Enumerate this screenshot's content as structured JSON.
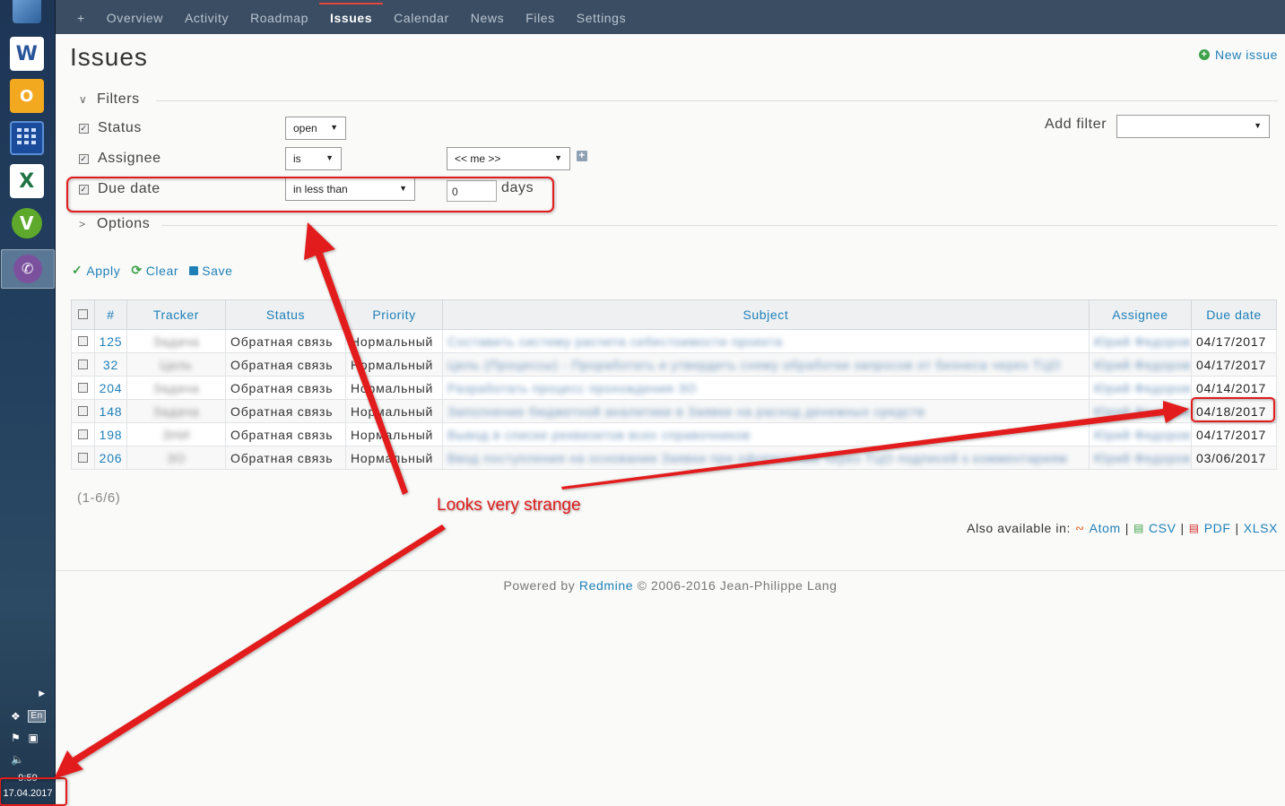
{
  "taskbar": {
    "apps": [
      "computer-icon",
      "word-icon",
      "outlook-icon",
      "calculator-icon",
      "excel-icon",
      "v-app-icon",
      "viber-icon"
    ],
    "app_letters": {
      "word": "W",
      "outlook": "O",
      "excel": "X",
      "v": "V"
    },
    "language": "En",
    "time": "9:59",
    "date": "17.04.2017"
  },
  "menu": {
    "plus": "+",
    "items": [
      "Overview",
      "Activity",
      "Roadmap",
      "Issues",
      "Calendar",
      "News",
      "Files",
      "Settings"
    ],
    "selected": "Issues",
    "accent": "#e8473c"
  },
  "page": {
    "title": "Issues",
    "new_issue": "New issue"
  },
  "filters": {
    "legend": "Filters",
    "rows": [
      {
        "label": "Status",
        "operator": "open",
        "checked": true
      },
      {
        "label": "Assignee",
        "operator": "is",
        "value": "<< me >>",
        "checked": true
      },
      {
        "label": "Due date",
        "operator": "in less than",
        "value": "0",
        "unit": "days",
        "checked": true
      }
    ],
    "add_filter": "Add filter",
    "add_filter_value": ""
  },
  "options": {
    "legend": "Options"
  },
  "actions": {
    "apply": "Apply",
    "clear": "Clear",
    "save": "Save"
  },
  "table": {
    "columns": [
      "#",
      "Tracker",
      "Status",
      "Priority",
      "Subject",
      "Assignee",
      "Due date"
    ],
    "rows": [
      {
        "id": "125",
        "tracker": "Задача",
        "status": "Обратная связь",
        "priority": "Нормальный",
        "subject": "Составить систему расчета себестоимости проекта",
        "assignee": "Юрий Федоров",
        "due": "04/17/2017"
      },
      {
        "id": "32",
        "tracker": "Цель",
        "status": "Обратная связь",
        "priority": "Нормальный",
        "subject": "Цель (Процессы) - Проработать и утвердить схему обработки запросов от бизнеса через ТЦО",
        "assignee": "Юрий Федоров",
        "due": "04/17/2017"
      },
      {
        "id": "204",
        "tracker": "Задача",
        "status": "Обратная связь",
        "priority": "Нормальный",
        "subject": "Разработать процесс прохождения ЗО",
        "assignee": "Юрий Федоров",
        "due": "04/14/2017"
      },
      {
        "id": "148",
        "tracker": "Задача",
        "status": "Обратная связь",
        "priority": "Нормальный",
        "subject": "Заполнение бюджетной аналитики в Заявке на расход денежных средств",
        "assignee": "Юрий Федоров",
        "due": "04/18/2017"
      },
      {
        "id": "198",
        "tracker": "ЗНИ",
        "status": "Обратная связь",
        "priority": "Нормальный",
        "subject": "Вывод в списке реквизитов всех справочников",
        "assignee": "Юрий Федоров",
        "due": "04/17/2017"
      },
      {
        "id": "206",
        "tracker": "ЗО",
        "status": "Обратная связь",
        "priority": "Нормальный",
        "subject": "Ввод поступления на основании Заявки при оформлении через ТЦО подписей к комментариям",
        "assignee": "Юрий Федоров",
        "due": "03/06/2017"
      }
    ]
  },
  "pagination": "(1-6/6)",
  "formats": {
    "label": "Also available in:",
    "items": [
      "Atom",
      "CSV",
      "PDF",
      "XLSX"
    ],
    "sep": "|"
  },
  "footer": {
    "prefix": "Powered by",
    "link": "Redmine",
    "suffix": "© 2006-2016 Jean-Philippe Lang"
  },
  "annotation": {
    "text": "Looks very strange",
    "color": "#e21b1b"
  }
}
